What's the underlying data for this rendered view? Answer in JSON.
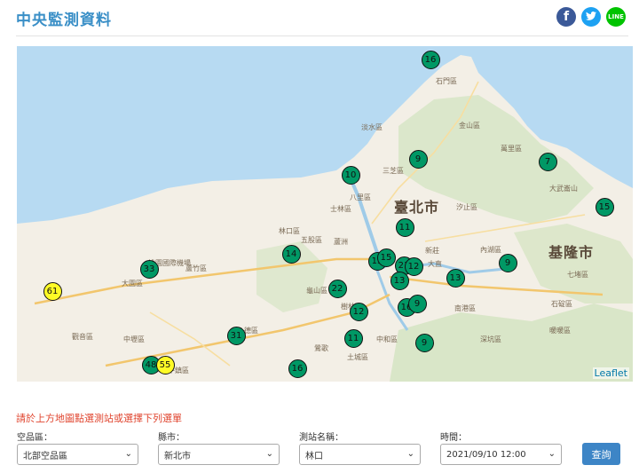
{
  "header": {
    "title": "中央監測資料",
    "share": [
      {
        "name": "facebook",
        "label": "f",
        "icon": "facebook-icon",
        "color": "#3b5998"
      },
      {
        "name": "twitter",
        "label": "t",
        "icon": "twitter-icon",
        "color": "#1da1f2"
      },
      {
        "name": "line",
        "label": "LINE",
        "icon": "line-icon",
        "color": "#00c300"
      }
    ]
  },
  "map": {
    "attribution": "Leaflet",
    "cities": [
      "臺北市",
      "基隆市"
    ],
    "districts": [
      "石門區",
      "金山區",
      "淡水區",
      "萬里區",
      "三芝區",
      "大武崙山",
      "八里區",
      "士林區",
      "汐止區",
      "五股區",
      "蘆洲",
      "林口區",
      "內湖區",
      "大直",
      "新莊",
      "龜山區",
      "樹林區",
      "中和區",
      "土城區",
      "南港區",
      "深坑區",
      "暖暖區",
      "七堵區",
      "桃園國際機場",
      "大園區",
      "蘆竹區",
      "觀音區",
      "中壢區",
      "平鎮區",
      "八德區",
      "三峽",
      "鶯歌",
      "石碇區"
    ],
    "aqi_colors": {
      "good": "#009865",
      "moderate": "#fffb26"
    },
    "stations": [
      {
        "value": "16",
        "level": "good"
      },
      {
        "value": "9",
        "level": "good"
      },
      {
        "value": "7",
        "level": "good"
      },
      {
        "value": "10",
        "level": "good"
      },
      {
        "value": "15",
        "level": "good"
      },
      {
        "value": "11",
        "level": "good"
      },
      {
        "value": "14",
        "level": "good"
      },
      {
        "value": "33",
        "level": "good"
      },
      {
        "value": "13",
        "level": "good"
      },
      {
        "value": "15",
        "level": "good"
      },
      {
        "value": "21",
        "level": "good"
      },
      {
        "value": "12",
        "level": "good"
      },
      {
        "value": "9",
        "level": "good"
      },
      {
        "value": "13",
        "level": "good"
      },
      {
        "value": "13",
        "level": "good"
      },
      {
        "value": "22",
        "level": "good"
      },
      {
        "value": "12",
        "level": "good"
      },
      {
        "value": "16",
        "level": "good"
      },
      {
        "value": "9",
        "level": "good"
      },
      {
        "value": "61",
        "level": "moderate"
      },
      {
        "value": "31",
        "level": "good"
      },
      {
        "value": "11",
        "level": "good"
      },
      {
        "value": "9",
        "level": "good"
      },
      {
        "value": "48",
        "level": "good"
      },
      {
        "value": "55",
        "level": "moderate"
      },
      {
        "value": "16",
        "level": "good"
      }
    ]
  },
  "form": {
    "hint": "請於上方地圖點選測站或選擇下列選單",
    "area_label": "空品區：",
    "area_value": "北部空品區",
    "county_label": "縣市：",
    "county_value": "新北市",
    "station_label": "測站名稱：",
    "station_value": "林口",
    "time_label": "時間：",
    "time_value": "2021/09/10 12:00",
    "query_label": "查詢"
  }
}
